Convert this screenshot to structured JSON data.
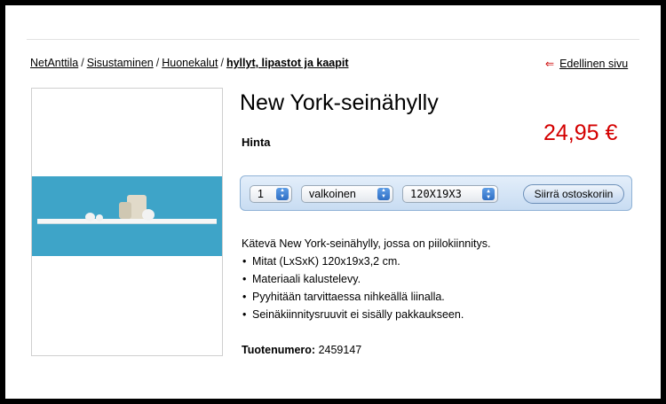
{
  "breadcrumb": {
    "items": [
      "NetAnttila",
      "Sisustaminen",
      "Huonekalut"
    ],
    "separator": "/",
    "current": "hyllyt, lipastot ja kaapit"
  },
  "nav": {
    "previous_page": "Edellinen sivu",
    "arrow": "⇐"
  },
  "product": {
    "title": "New York-seinähylly",
    "price_label": "Hinta",
    "price": "24,95 €",
    "sku_label": "Tuotenumero:",
    "sku": "2459147"
  },
  "cart": {
    "quantity": "1",
    "color": "valkoinen",
    "size": "120X19X3",
    "add_button": "Siirrä ostoskoriin"
  },
  "description": {
    "intro": "Kätevä New York-seinähylly, jossa on piilokiinnitys.",
    "bullets": [
      "Mitat (LxSxK) 120x19x3,2 cm.",
      "Materiaali kalustelevy.",
      "Pyyhitään tarvittaessa nihkeällä liinalla.",
      "Seinäkiinnitysruuvit ei sisälly pakkaukseen."
    ]
  },
  "colors": {
    "price": "#d40000",
    "cart_bar": "#c8dcf2",
    "image_wall": "#3ea4c8"
  },
  "icons": {
    "select_arrows": "updown-arrows-icon",
    "back_arrow": "left-arrow-icon"
  }
}
